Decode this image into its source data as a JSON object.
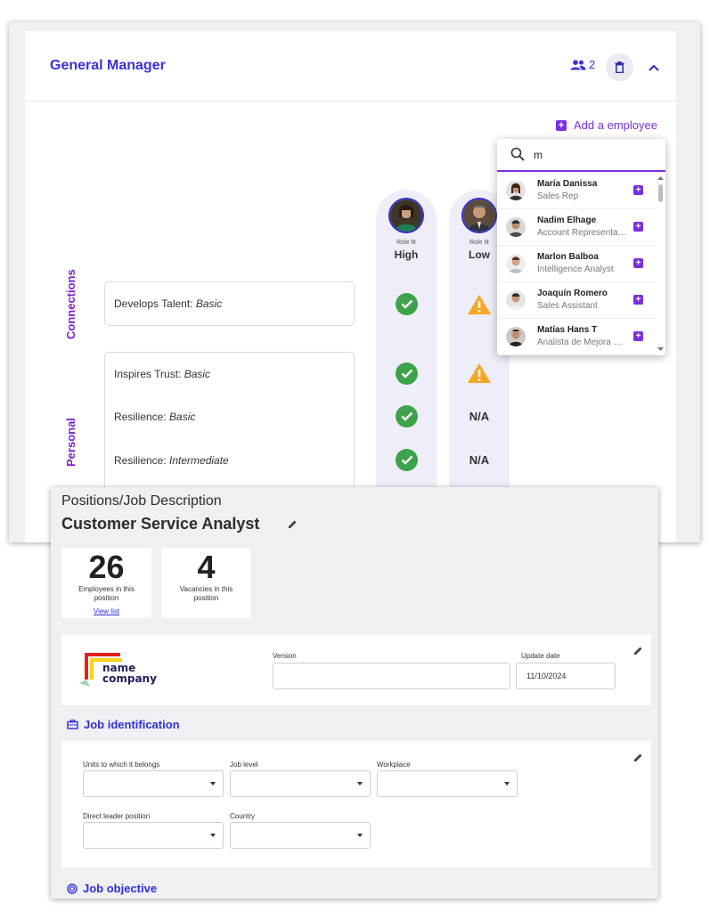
{
  "general_manager": {
    "title": "General Manager",
    "people_count": "2",
    "add_employee": "Add a employee"
  },
  "categories": {
    "connections": "Connections",
    "personal": "Personal"
  },
  "skills": {
    "develops_talent": {
      "name": "Develops Talent: ",
      "level": "Basic"
    },
    "inspires_trust": {
      "name": "Inspires Trust: ",
      "level": "Basic"
    },
    "resilience_1": {
      "name": "Resilience: ",
      "level": "Basic"
    },
    "resilience_2": {
      "name": "Resilience: ",
      "level": "Intermediate"
    }
  },
  "employee_columns": [
    {
      "role_fit_label": "Role fit",
      "role_fit": "High"
    },
    {
      "role_fit_label": "Role fit",
      "role_fit": "Low",
      "na_1": "N/A",
      "na_2": "N/A"
    }
  ],
  "search_dropdown": {
    "query": "m",
    "results": [
      {
        "name": "María Danissa",
        "role": "Sales Rep"
      },
      {
        "name": "Nadim Elhage",
        "role": "Account Representative"
      },
      {
        "name": "Marlon Balboa",
        "role": "Intelligence Analyst"
      },
      {
        "name": "Joaquín Romero",
        "role": "Sales Assistant"
      },
      {
        "name": "Matías Hans T",
        "role": "Analista de Mejora Continua"
      }
    ]
  },
  "job_description": {
    "breadcrumb": "Positions/Job Description",
    "title": "Customer Service Analyst",
    "stats": {
      "employees_count": "26",
      "employees_label": "Employees in this position",
      "view_list": "View list",
      "vacancies_count": "4",
      "vacancies_label": "Vacancies in this position"
    },
    "company_logo": {
      "line1": "name",
      "line2": "company"
    },
    "version_label": "Version",
    "version_value": "",
    "update_date_label": "Update date",
    "update_date_value": "11/10/2024",
    "job_identification": {
      "heading": "Job identification",
      "units_label": "Units to which it belongs",
      "job_level_label": "Job level",
      "workplace_label": "Workplace",
      "direct_leader_label": "Direct leader position",
      "country_label": "Country"
    },
    "job_objective": {
      "heading": "Job objective"
    }
  },
  "colors": {
    "accent": "#3b2fe0",
    "purple": "#7b2fe0",
    "success": "#3da34b",
    "warning": "#f5a623"
  }
}
